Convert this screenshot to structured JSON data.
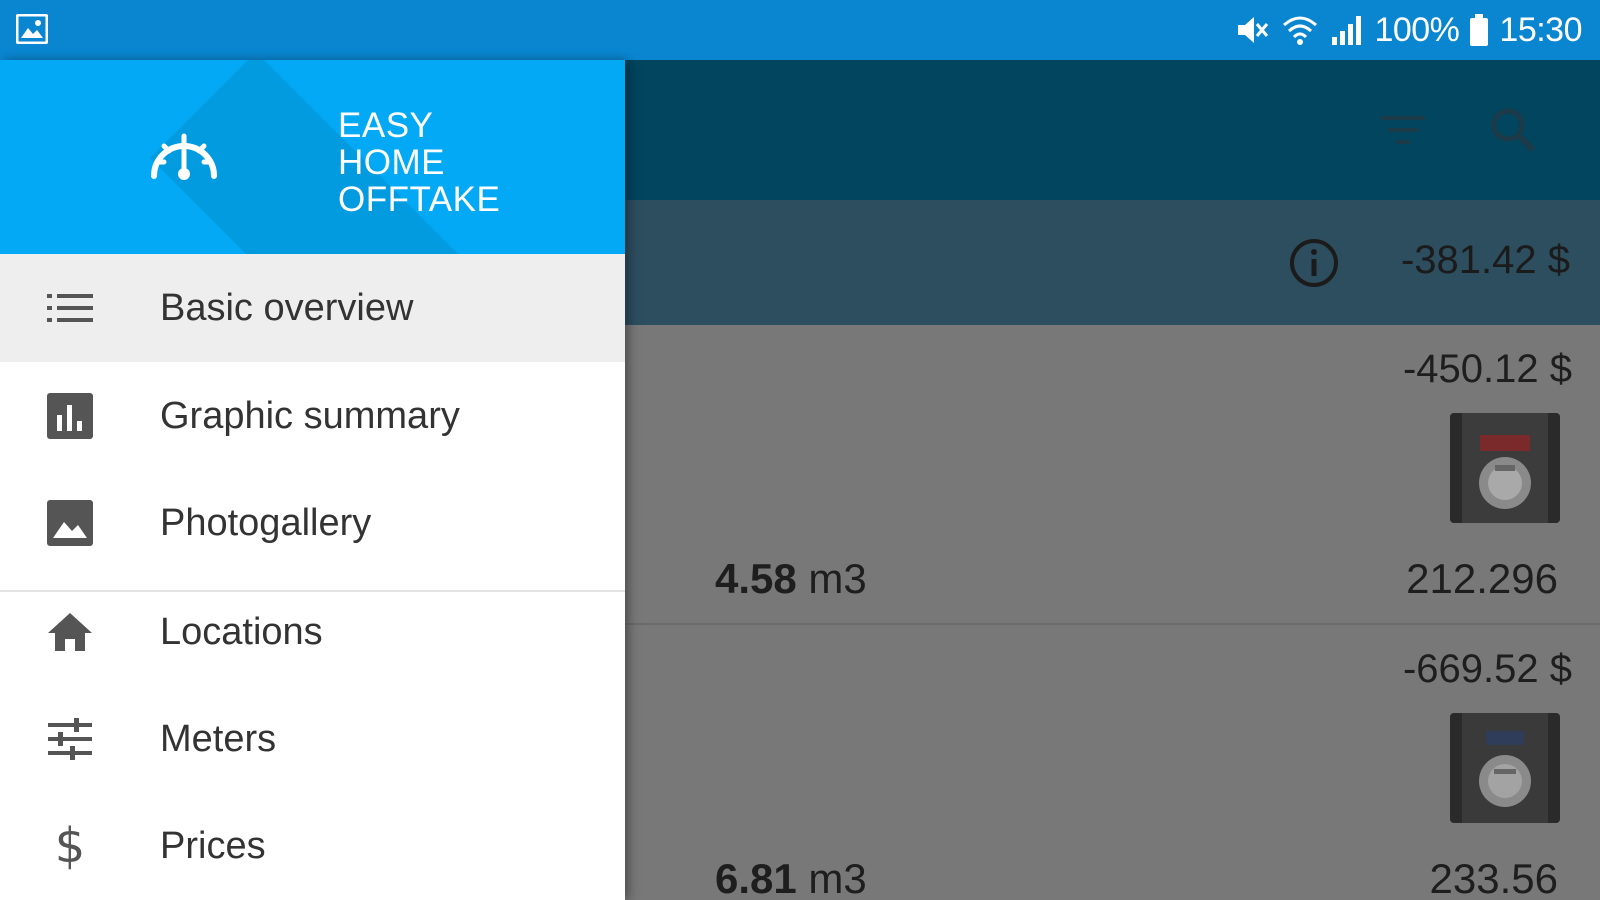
{
  "status_bar": {
    "battery_percent": "100%",
    "time": "15:30"
  },
  "drawer": {
    "app_title_lines": [
      "EASY",
      "HOME",
      "OFFTAKE"
    ],
    "items": [
      {
        "label": "Basic overview",
        "icon": "list-icon",
        "active": true
      },
      {
        "label": "Graphic summary",
        "icon": "bar-chart-icon",
        "active": false
      },
      {
        "label": "Photogallery",
        "icon": "image-icon",
        "active": false
      },
      {
        "label": "Locations",
        "icon": "home-icon",
        "active": false
      },
      {
        "label": "Meters",
        "icon": "sliders-icon",
        "active": false
      },
      {
        "label": "Prices",
        "icon": "dollar-icon",
        "active": false
      }
    ]
  },
  "summary": {
    "total": "-381.42 $"
  },
  "readings": [
    {
      "price": "-450.12 $",
      "quantity_value": "4.58",
      "quantity_unit": "m3",
      "reading": "212.296"
    },
    {
      "price": "-669.52 $",
      "quantity_value": "6.81",
      "quantity_unit": "m3",
      "reading": "233.56"
    }
  ],
  "colors": {
    "status_bar": "#0a86d1",
    "drawer_header": "#03a9f4",
    "app_bar": "#01455f"
  }
}
